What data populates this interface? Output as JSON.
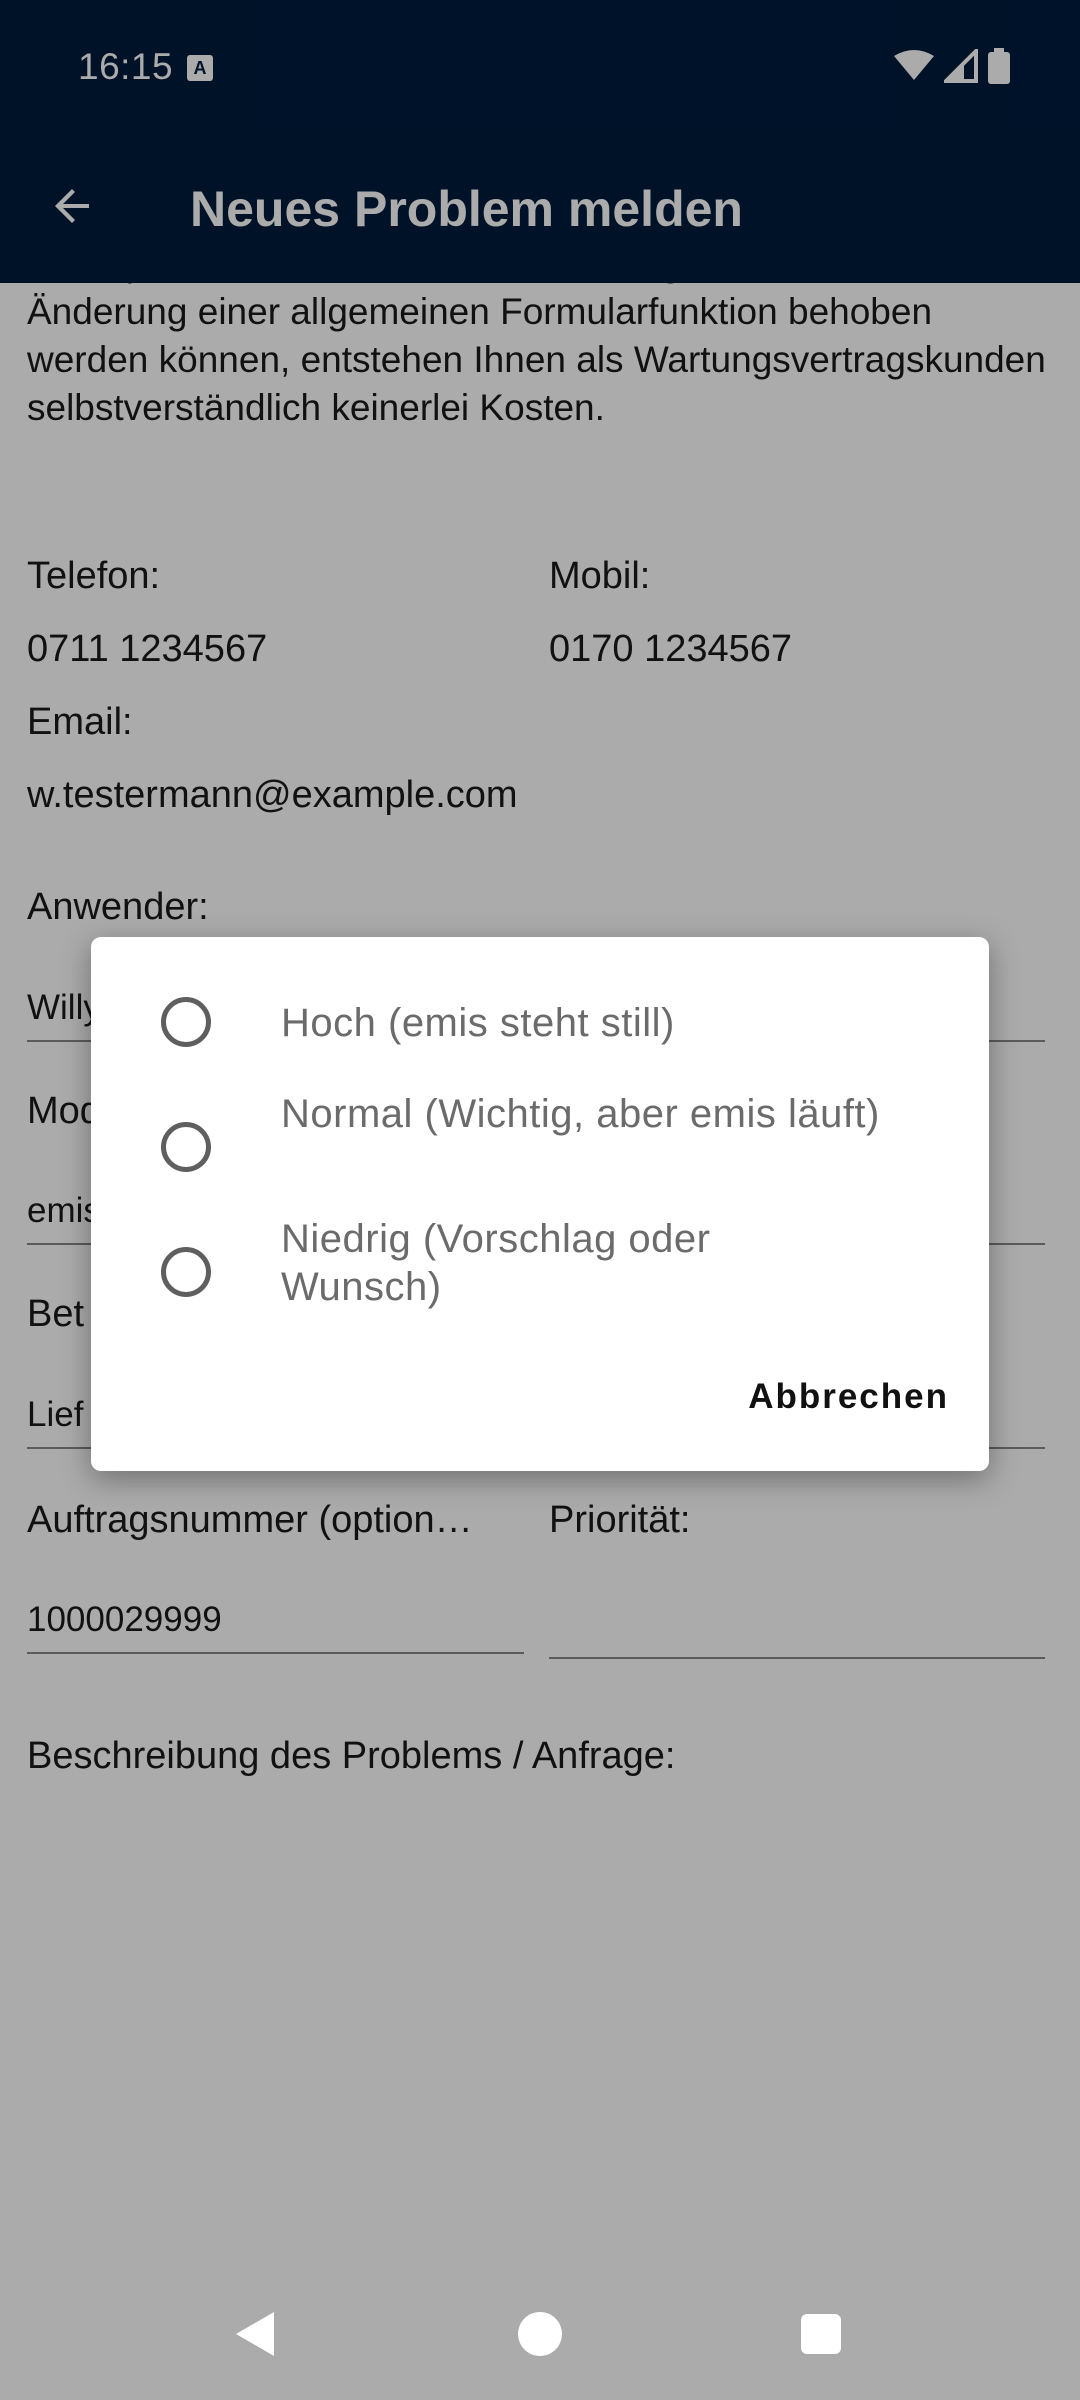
{
  "status_bar": {
    "time": "16:15",
    "a_badge": "A"
  },
  "app_bar": {
    "title": "Neues Problem melden"
  },
  "content": {
    "intro_text": "emisupdates, den Austausch einer Programmdatei oder der Änderung einer allgemeinen Formularfunktion behoben werden können, entstehen Ihnen als Wartungsvertragskunden selbstverständlich keinerlei Kosten.",
    "telefon_label": "Telefon:",
    "telefon_value": "0711 1234567",
    "mobil_label": "Mobil:",
    "mobil_value": "0170 1234567",
    "email_label": "Email:",
    "email_value": "w.testermann@example.com",
    "anwender_label": "Anwender:",
    "anwender_value": "Willy",
    "modul_label": "Mod",
    "modul_value": "emis",
    "betreff_label": "Bet",
    "betreff_value": "Lief",
    "auftrag_label": "Auftragsnummer (option…",
    "auftrag_value": "1000029999",
    "prioritaet_label": "Priorität:",
    "prioritaet_value": "",
    "beschreibung_label": "Beschreibung des Problems / Anfrage:"
  },
  "dialog": {
    "options": [
      {
        "label": "Hoch (emis steht still)",
        "selected": false
      },
      {
        "label": "Normal (Wichtig, aber emis läuft)",
        "selected": false
      },
      {
        "label": "Niedrig (Vorschlag oder Wunsch)",
        "selected": false
      }
    ],
    "cancel_label": "Abbrechen"
  },
  "colors": {
    "app_bar": "#001b3d",
    "scrim": "rgba(0,0,0,0.33)"
  }
}
